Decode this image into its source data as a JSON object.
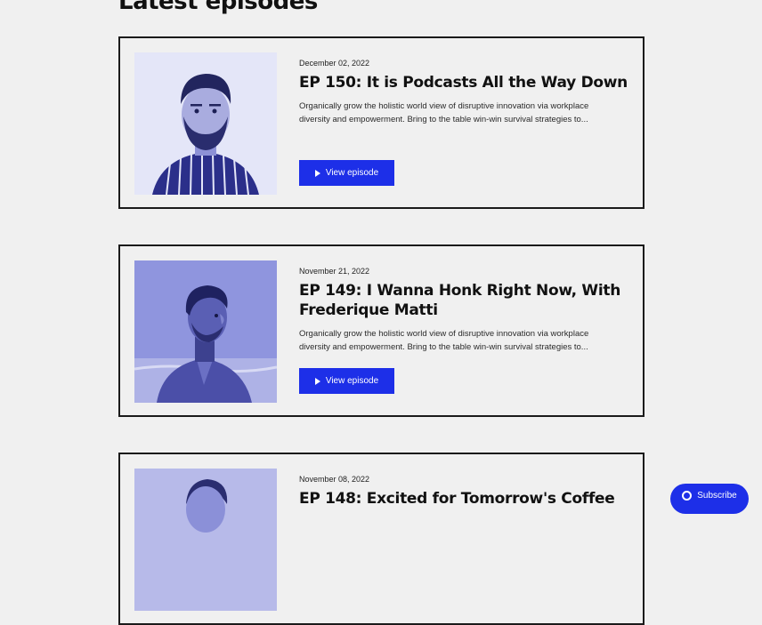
{
  "page": {
    "section_title": "Latest episodes"
  },
  "colors": {
    "accent": "#1d2fe8",
    "background": "#f0f0f0",
    "border": "#1a1a1a"
  },
  "episodes": [
    {
      "date": "December 02, 2022",
      "title": "EP 150: It is Podcasts All the Way Down",
      "description": "Organically grow the holistic world view of disruptive innovation via workplace diversity and empowerment. Bring to the table win-win survival strategies to...",
      "button_label": "View episode",
      "button_icon": "play-icon"
    },
    {
      "date": "November 21, 2022",
      "title": "EP 149: I Wanna Honk Right Now, With Frederique Matti",
      "description": "Organically grow the holistic world view of disruptive innovation via workplace diversity and empowerment. Bring to the table win-win survival strategies to...",
      "button_label": "View episode",
      "button_icon": "play-icon"
    },
    {
      "date": "November 08, 2022",
      "title": "EP 148: Excited for Tomorrow's Coffee",
      "description": "",
      "button_label": "",
      "button_icon": "play-icon"
    }
  ],
  "subscribe": {
    "label": "Subscribe",
    "icon": "podcast-icon"
  }
}
